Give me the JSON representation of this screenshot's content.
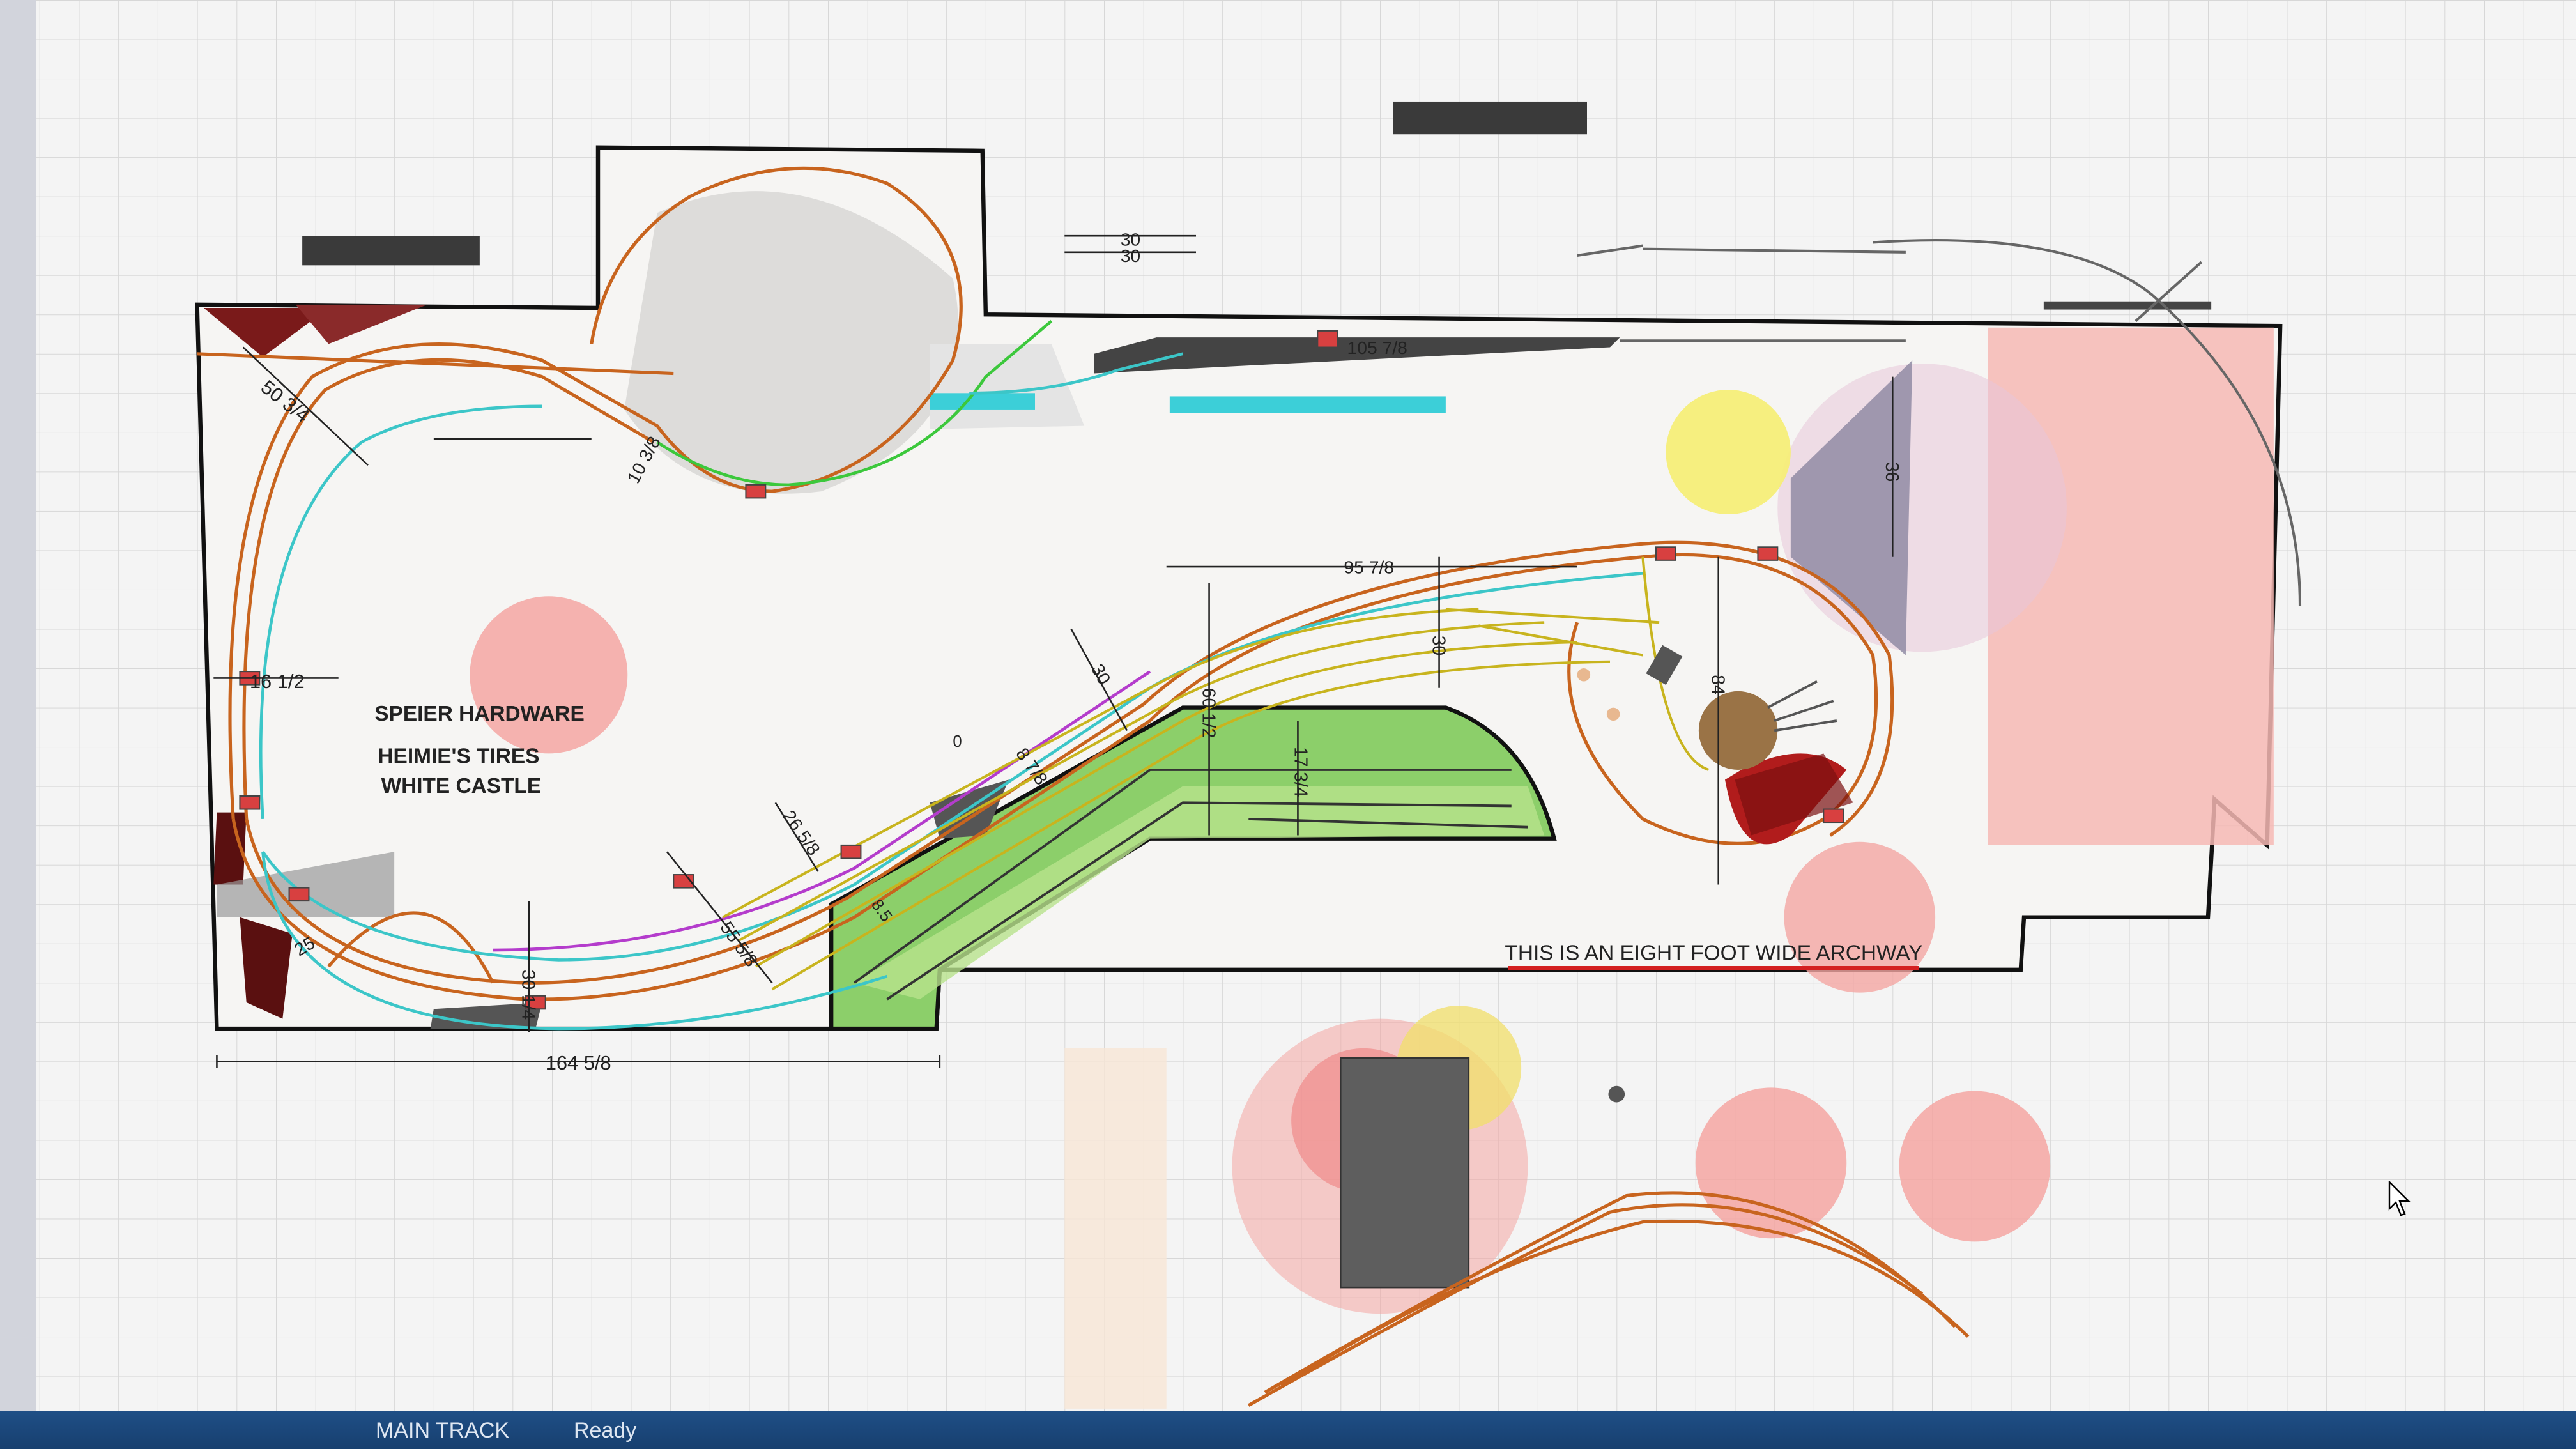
{
  "layout": {
    "dimensions": {
      "left_wall_diag": "50 3/4",
      "upper_loop": "10 3/8",
      "left_end": "16 1/2",
      "spur_30": "30",
      "siding_top": "105 7/8",
      "center_top": "95 7/8",
      "center_30": "30",
      "center_30_b": "30",
      "center_60": "60 1/2",
      "diag_26": "26 5/8",
      "diag_8": "8 7/8",
      "diag_55": "55 5/8",
      "bottom_30": "30 1/4",
      "bottom_overall": "164 5/8",
      "pen_17": "17 3/4",
      "right_84": "84",
      "right_36": "36",
      "left_25": "25",
      "small_0": "0",
      "small_86": "8.5"
    },
    "town_labels": [
      "SPEIER HARDWARE",
      "HEIMIE'S TIRES",
      "WHITE CASTLE"
    ],
    "archway_note": "THIS IS AN EIGHT FOOT WIDE ARCHWAY"
  },
  "status": {
    "layer": "MAIN TRACK",
    "state": "Ready"
  },
  "colors": {
    "track_main": "#c8641e",
    "track_cyan": "#3cc6c8",
    "track_yellow": "#c8b41e",
    "track_magenta": "#b43ccc",
    "track_green": "#3cc83c",
    "status_bar": "#1f4f86"
  }
}
